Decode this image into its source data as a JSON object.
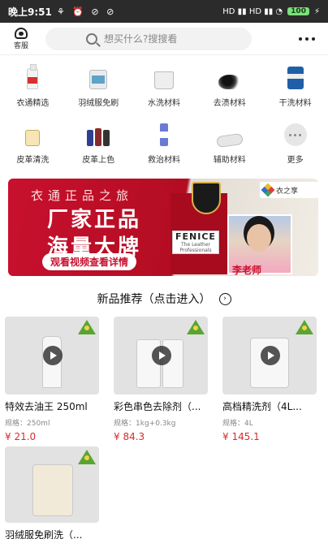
{
  "status": {
    "time": "晚上9:51",
    "notif_icons": "⚘ ⏰ ⊘ ⊘",
    "signal": "HD ▮▮ HD ▮▮ ◔",
    "battery": "100",
    "charging": "⚡"
  },
  "topbar": {
    "service_label": "客服",
    "search_placeholder": "想买什么?搜搜看"
  },
  "categories": [
    {
      "label": "衣通精选",
      "icon": "bottle-icon"
    },
    {
      "label": "羽绒服免刷",
      "icon": "tub-icon"
    },
    {
      "label": "水洗材料",
      "icon": "bucket-icon"
    },
    {
      "label": "去渍材料",
      "icon": "powder-icon"
    },
    {
      "label": "干洗材料",
      "icon": "drum-icon"
    },
    {
      "label": "皮革清洗",
      "icon": "jar-icon"
    },
    {
      "label": "皮革上色",
      "icon": "bottles-icon"
    },
    {
      "label": "救治材料",
      "icon": "vial-icon"
    },
    {
      "label": "辅助材料",
      "icon": "roll-icon"
    },
    {
      "label": "更多",
      "icon": "more-icon"
    }
  ],
  "banner": {
    "subtitle": "衣通正品之旅",
    "title_line1": "厂家正品",
    "title_line2": "海量大牌",
    "cta": "观看视频查看详情",
    "brand": "FENICE",
    "brand_tagline": "The Leather Professionals",
    "signature": "李老师",
    "logo_text": "衣之享"
  },
  "section": {
    "title": "新品推荐（点击进入）"
  },
  "products": [
    {
      "name": "特效去油王 250ml",
      "spec": "规格：250ml",
      "price": "¥ 21.0"
    },
    {
      "name": "彩色串色去除剂（...",
      "spec": "规格：1kg+0.3kg",
      "price": "¥ 84.3"
    },
    {
      "name": "高档精洗剂（4L...",
      "spec": "规格：4L",
      "price": "¥ 145.1"
    },
    {
      "name": "羽绒服免刷洗（...",
      "spec": "",
      "price": ""
    }
  ],
  "colors": {
    "accent_red": "#d92b2b",
    "banner_red": "#c8102e",
    "badge_green": "#5aa532"
  }
}
